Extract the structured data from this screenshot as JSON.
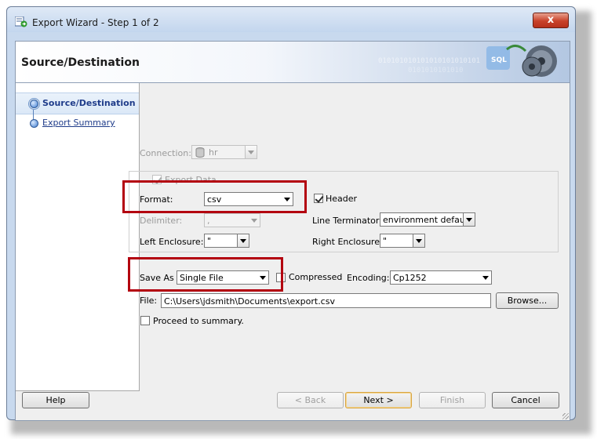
{
  "window": {
    "title": "Export Wizard - Step 1 of 2",
    "close_glyph": "x"
  },
  "header": {
    "title": "Source/Destination",
    "binary_line1": "010101010101010101010101",
    "binary_line2": "0101010101010"
  },
  "steps": [
    {
      "label": "Source/Destination",
      "active": true
    },
    {
      "label": "Export Summary",
      "active": false
    }
  ],
  "form": {
    "connection_label": "Connection:",
    "connection_value": "hr",
    "export_data_label": "Export Data",
    "export_data_checked": true,
    "format_label": "Format:",
    "format_value": "csv",
    "header_label": "Header",
    "header_checked": true,
    "delimiter_label": "Delimiter:",
    "delimiter_value": ",",
    "line_terminator_label": "Line Terminator:",
    "line_terminator_value": "environment default",
    "left_enclosure_label": "Left Enclosure:",
    "left_enclosure_value": "\"",
    "right_enclosure_label": "Right Enclosure:",
    "right_enclosure_value": "\"",
    "save_as_label": "Save As",
    "save_as_value": "Single File",
    "compressed_label": "Compressed",
    "compressed_checked": false,
    "encoding_label": "Encoding:",
    "encoding_value": "Cp1252",
    "file_label": "File:",
    "file_value": "C:\\Users\\jdsmith\\Documents\\export.csv",
    "browse_label": "Browse...",
    "proceed_label": "Proceed to summary.",
    "proceed_checked": false
  },
  "buttons": {
    "help": "Help",
    "back": "< Back",
    "next": "Next >",
    "finish": "Finish",
    "cancel": "Cancel"
  },
  "colors": {
    "highlight_box": "#b3000f",
    "step_link": "#1f3c8a"
  }
}
